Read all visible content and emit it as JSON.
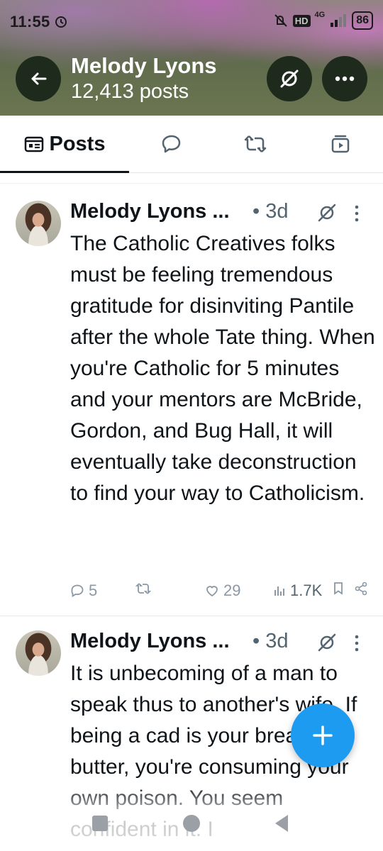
{
  "status_bar": {
    "time": "11:55",
    "hd": "HD",
    "network": "4G",
    "battery": "86"
  },
  "header": {
    "name": "Melody Lyons",
    "posts_count": "12,413 posts"
  },
  "tabs": [
    {
      "label": "Posts",
      "icon": "posts-icon",
      "active": true
    },
    {
      "label": "",
      "icon": "replies-icon"
    },
    {
      "label": "",
      "icon": "reposts-icon"
    },
    {
      "label": "",
      "icon": "media-icon"
    }
  ],
  "posts": [
    {
      "author": "Melody Lyons ...",
      "time": "• 3d",
      "text": "The Catholic Creatives folks must be feeling tremendous gratitude for disinviting Pantile after the whole Tate thing. When you're Catholic for 5 minutes and your mentors are McBride, Gordon, and Bug Hall, it will eventually take deconstruction to find your way to Catholicism.",
      "replies": "5",
      "reposts": "",
      "likes": "29",
      "views": "1.7K"
    },
    {
      "author": "Melody Lyons ...",
      "time": "• 3d",
      "text": "It is unbecoming of a man to speak thus to another's wife. If being a cad is your bread and butter, you're consuming your own poison. You seem confident in it. I"
    }
  ],
  "colors": {
    "accent": "#1d9bf0",
    "text": "#0f1419",
    "muted": "#536471"
  }
}
